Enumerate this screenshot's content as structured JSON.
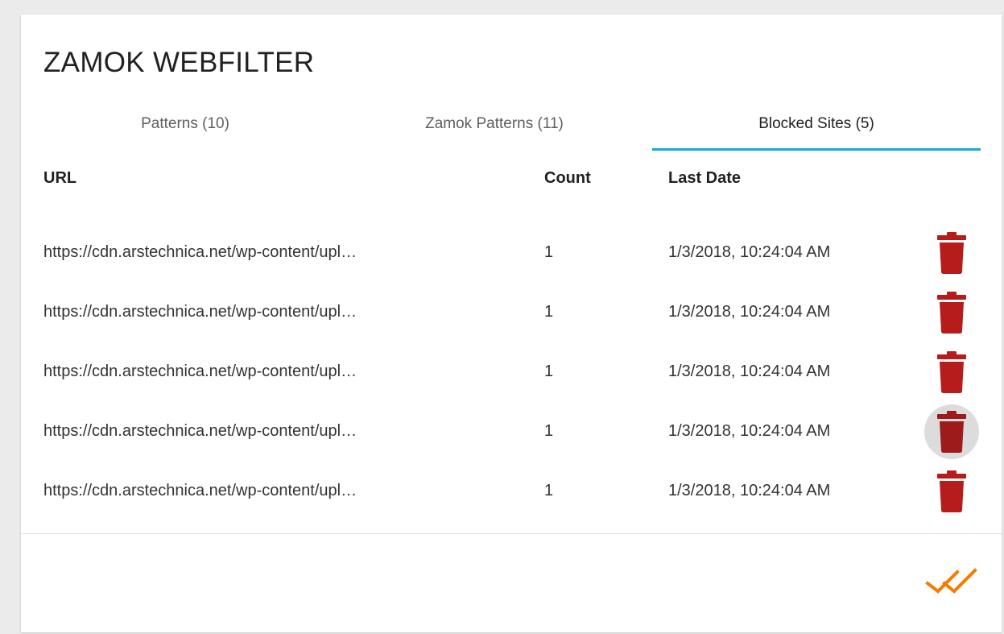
{
  "app": {
    "title": "ZAMOK WEBFILTER"
  },
  "tabs": [
    {
      "label": "Patterns (10)"
    },
    {
      "label": "Zamok Patterns (11)"
    },
    {
      "label": "Blocked Sites (5)"
    }
  ],
  "table": {
    "headers": {
      "url": "URL",
      "count": "Count",
      "date": "Last Date"
    },
    "rows": [
      {
        "url": "https://cdn.arstechnica.net/wp-content/upl…",
        "count": "1",
        "date": "1/3/2018, 10:24:04 AM"
      },
      {
        "url": "https://cdn.arstechnica.net/wp-content/upl…",
        "count": "1",
        "date": "1/3/2018, 10:24:04 AM"
      },
      {
        "url": "https://cdn.arstechnica.net/wp-content/upl…",
        "count": "1",
        "date": "1/3/2018, 10:24:04 AM"
      },
      {
        "url": "https://cdn.arstechnica.net/wp-content/upl…",
        "count": "1",
        "date": "1/3/2018, 10:24:04 AM"
      },
      {
        "url": "https://cdn.arstechnica.net/wp-content/upl…",
        "count": "1",
        "date": "1/3/2018, 10:24:04 AM"
      }
    ]
  },
  "icons": {
    "delete": "trash-icon",
    "done": "double-check-icon"
  },
  "colors": {
    "accent": "#11b0c9",
    "delete": "#b71c1c",
    "delete_hover": "#9e1b1b",
    "done": "#f57c00"
  }
}
